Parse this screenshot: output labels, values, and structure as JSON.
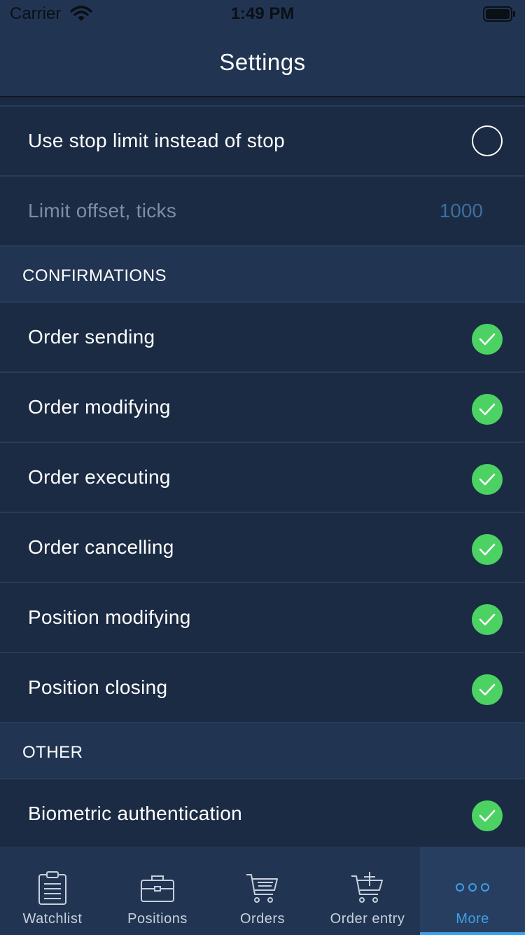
{
  "status": {
    "carrier": "Carrier",
    "time": "1:49 PM"
  },
  "header": {
    "title": "Settings"
  },
  "stop_settings": {
    "use_stop_limit": {
      "label": "Use stop limit instead of stop",
      "checked": false
    },
    "limit_offset": {
      "label": "Limit offset, ticks",
      "value": "1000"
    }
  },
  "confirmations": {
    "title": "CONFIRMATIONS",
    "items": [
      {
        "label": "Order sending",
        "checked": true
      },
      {
        "label": "Order modifying",
        "checked": true
      },
      {
        "label": "Order executing",
        "checked": true
      },
      {
        "label": "Order cancelling",
        "checked": true
      },
      {
        "label": "Position modifying",
        "checked": true
      },
      {
        "label": "Position closing",
        "checked": true
      }
    ]
  },
  "other": {
    "title": "OTHER",
    "items": [
      {
        "label": "Biometric authentication",
        "checked": true
      }
    ]
  },
  "tabs": [
    {
      "label": "Watchlist",
      "icon": "clipboard-list-icon"
    },
    {
      "label": "Positions",
      "icon": "briefcase-icon"
    },
    {
      "label": "Orders",
      "icon": "cart-list-icon"
    },
    {
      "label": "Order entry",
      "icon": "cart-plus-icon"
    },
    {
      "label": "More",
      "icon": "more-dots-icon",
      "active": true
    }
  ],
  "colors": {
    "background": "#1b2b44",
    "header": "#213553",
    "check_green": "#4cd263",
    "accent": "#3d9fe6",
    "muted_value": "#3d6e9e"
  }
}
